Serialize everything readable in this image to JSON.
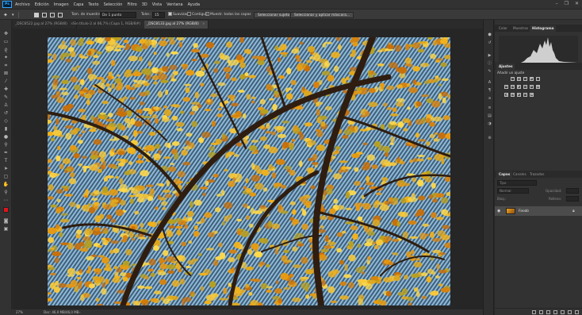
{
  "menu": {
    "logo": "Ps",
    "items": [
      "Archivo",
      "Edición",
      "Imagen",
      "Capa",
      "Texto",
      "Selección",
      "Filtro",
      "3D",
      "Vista",
      "Ventana",
      "Ayuda"
    ],
    "window_controls": [
      "–",
      "❐",
      "✕"
    ]
  },
  "options": {
    "sample_size_label": "Tam. de muestra:",
    "sample_size_value": "De 1 punto",
    "tolerance_label": "Toler.:",
    "tolerance_value": "15",
    "smooth_label": "Suavizar",
    "contiguous_label": "Contiguo",
    "sample_all_label": "Muestr. todas las capas",
    "select_subject_label": "Seleccionar sujeto",
    "select_mask_label": "Seleccionar y aplicar máscara..."
  },
  "tabs": [
    {
      "label": "_DSC8522.jpg al 27% (RGB/8)",
      "close": "×"
    },
    {
      "label": "Sin título-2 al 66,7% (Capa 1, RGB/8#)",
      "close": "×"
    },
    {
      "label": "_DSC8133.jpg al 27% (RGB/8)",
      "close": "×"
    }
  ],
  "status": {
    "zoom": "27%",
    "doc": "Doc: 46,0 MB/46,0 MB"
  },
  "histogram_panel": {
    "tabs": [
      "Color",
      "Muestras",
      "Histograma"
    ]
  },
  "adjustments_panel": {
    "title": "Ajustes",
    "subtitle": "Añadir un ajuste"
  },
  "layers_panel": {
    "tabs": [
      "Capas",
      "Canales",
      "Trazados"
    ],
    "search_placeholder": "Tipo",
    "blend_mode": "Normal",
    "opacity_label": "Opacidad:",
    "lock_label": "Bloq.:",
    "fill_label": "Relleno:",
    "layer_name": "Fondo"
  },
  "colors": {
    "foreground": "#e0141b",
    "background": "#ffffff",
    "accent": "#31a8ff"
  }
}
